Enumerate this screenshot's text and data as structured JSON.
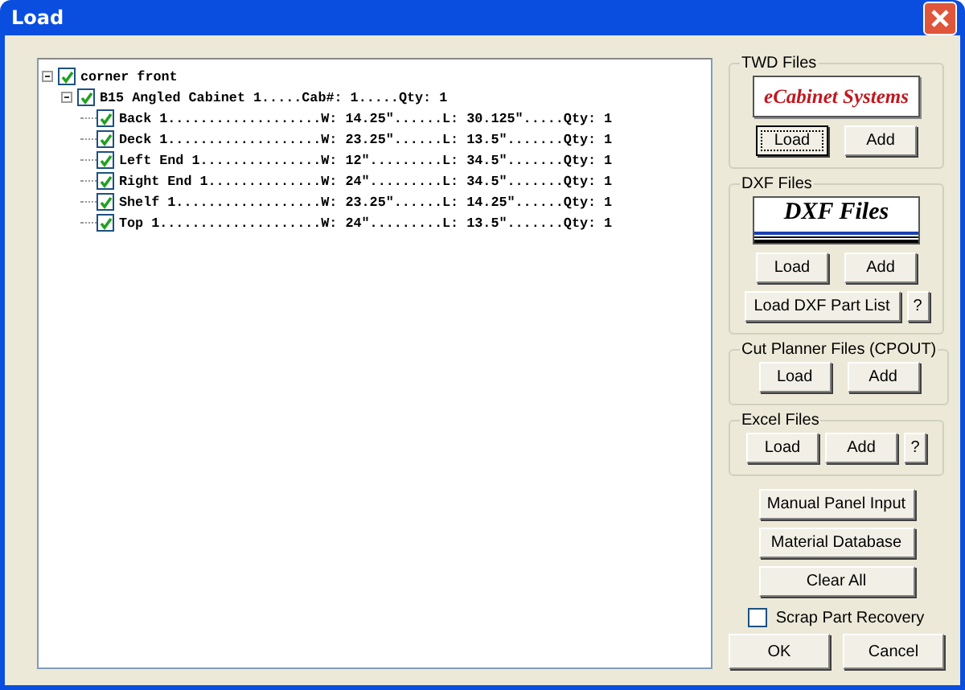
{
  "window": {
    "title": "Load"
  },
  "tree": [
    {
      "label": "corner front",
      "checked": true,
      "expanded": true,
      "children": [
        {
          "label": "B15 Angled Cabinet 1.....Cab#: 1.....Qty: 1",
          "checked": true,
          "expanded": true,
          "children": [
            {
              "label": "Back 1...................W: 14.25\"......L: 30.125\".....Qty: 1",
              "checked": true
            },
            {
              "label": "Deck 1...................W: 23.25\"......L: 13.5\".......Qty: 1",
              "checked": true
            },
            {
              "label": "Left End 1...............W: 12\".........L: 34.5\".......Qty: 1",
              "checked": true
            },
            {
              "label": "Right End 1..............W: 24\".........L: 34.5\".......Qty: 1",
              "checked": true
            },
            {
              "label": "Shelf 1..................W: 23.25\"......L: 14.25\"......Qty: 1",
              "checked": true
            },
            {
              "label": "Top 1....................W: 24\".........L: 13.5\".......Qty: 1",
              "checked": true
            }
          ]
        }
      ]
    }
  ],
  "groups": [
    {
      "title": "TWD Files",
      "logo": {
        "kind": "ecabinet",
        "text": "eCabinet Systems"
      },
      "buttons": [
        {
          "label": "Load",
          "focused": true
        },
        {
          "label": "Add",
          "focused": false
        }
      ]
    },
    {
      "title": "DXF Files",
      "logo": {
        "kind": "dxf",
        "text": "DXF Files"
      },
      "buttons": [
        {
          "label": "Load",
          "focused": false
        },
        {
          "label": "Add",
          "focused": false
        }
      ],
      "part_list_button": "Load DXF Part List",
      "help_button": "?"
    },
    {
      "title": "Cut Planner Files (CPOUT)",
      "buttons": [
        {
          "label": "Load",
          "focused": false
        },
        {
          "label": "Add",
          "focused": false
        }
      ]
    },
    {
      "title": "Excel Files",
      "buttons": [
        {
          "label": "Load",
          "focused": false
        },
        {
          "label": "Add",
          "focused": false
        }
      ],
      "help_button": "?"
    }
  ],
  "actions": [
    "Manual Panel Input",
    "Material Database",
    "Clear All"
  ],
  "scrap_recovery": {
    "label": "Scrap Part Recovery",
    "checked": false
  },
  "footer_buttons": [
    "OK",
    "Cancel"
  ]
}
